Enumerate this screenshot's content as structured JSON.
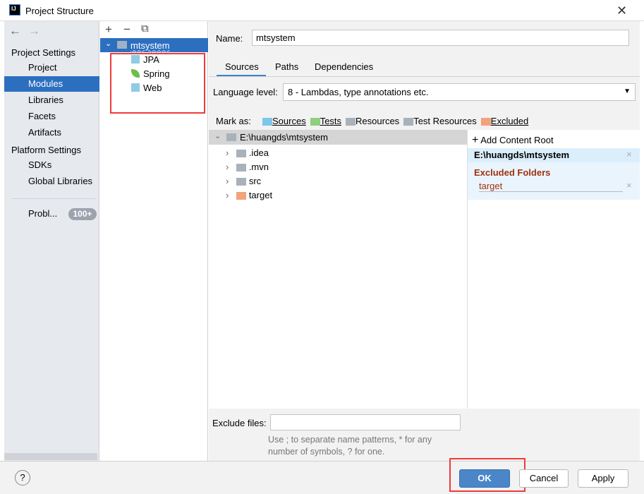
{
  "window": {
    "title": "Project Structure",
    "logo": "IJ"
  },
  "nav": {
    "back": "←",
    "forward": "→",
    "project_settings": "Project Settings",
    "project_items": [
      {
        "label": "Project"
      },
      {
        "label": "Modules",
        "selected": true
      },
      {
        "label": "Libraries"
      },
      {
        "label": "Facets"
      },
      {
        "label": "Artifacts"
      }
    ],
    "platform_settings": "Platform Settings",
    "platform_items": [
      {
        "label": "SDKs"
      },
      {
        "label": "Global Libraries"
      }
    ],
    "problems": {
      "label": "Probl...",
      "count": "100+"
    }
  },
  "modules": {
    "toolbar": {
      "add": "+",
      "remove": "−",
      "copy": "⧉"
    },
    "module": "mtsystem",
    "facets": [
      {
        "label": "JPA",
        "icon": "jpa-icon"
      },
      {
        "label": "Spring",
        "icon": "spring-leaf-icon"
      },
      {
        "label": "Web",
        "icon": "web-icon"
      }
    ]
  },
  "detail": {
    "name_label": "Name:",
    "name_value": "mtsystem",
    "tabs": [
      {
        "label": "Sources",
        "active": true
      },
      {
        "label": "Paths"
      },
      {
        "label": "Dependencies"
      }
    ],
    "language_label": "Language level:",
    "language_value": "8 - Lambdas, type annotations etc.",
    "mark_as": "Mark as:",
    "marks": [
      {
        "label": "Sources",
        "color": "#7cc7ea"
      },
      {
        "label": "Tests",
        "color": "#8fcf7c"
      },
      {
        "label": "Resources",
        "color": "#a9b2ba"
      },
      {
        "label": "Test Resources",
        "color": "#a9b2ba"
      },
      {
        "label": "Excluded",
        "color": "#f2a37b"
      }
    ],
    "root": "E:\\huangds\\mtsystem",
    "folders": [
      {
        "label": ".idea",
        "color": "#a9b2ba"
      },
      {
        "label": ".mvn",
        "color": "#a9b2ba"
      },
      {
        "label": "src",
        "color": "#a9b2ba"
      },
      {
        "label": "target",
        "color": "#f2a37b"
      }
    ],
    "add_content_root": "Add Content Root",
    "content_root": "E:\\huangds\\mtsystem",
    "excluded_title": "Excluded Folders",
    "excluded": [
      "target"
    ],
    "exclude_files_label": "Exclude files:",
    "exclude_files_value": "",
    "hint": "Use ; to separate name patterns, * for any number of symbols, ? for one."
  },
  "footer": {
    "help": "?",
    "ok": "OK",
    "cancel": "Cancel",
    "apply": "Apply"
  },
  "colors": {
    "accent": "#2d6fbf",
    "highlight_box": "#f03a3a",
    "excluded_text": "#a0330f"
  }
}
